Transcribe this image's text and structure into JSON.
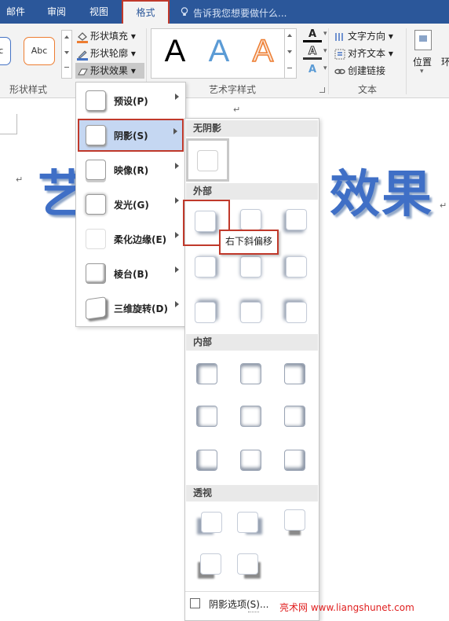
{
  "tabs": [
    "邮件",
    "审阅",
    "视图",
    "格式"
  ],
  "tell_me": "告诉我您想要做什么...",
  "ribbon": {
    "shape_style_thumb": "Abc",
    "shape_fill": "形状填充",
    "shape_outline": "形状轮廓",
    "shape_effects": "形状效果",
    "group_shape_styles": "形状样式",
    "wordart_letter": "A",
    "group_wordart": "艺术字样式",
    "text_direction": "文字方向",
    "align_text": "对齐文本",
    "create_link": "创建链接",
    "group_text": "文本",
    "position": "位置",
    "wrap_partial": "环"
  },
  "doc": {
    "art_left": "艺",
    "art_right": "效果",
    "para_mark": "↵"
  },
  "effects_menu": [
    {
      "label": "预设(P)"
    },
    {
      "label": "阴影(S)"
    },
    {
      "label": "映像(R)"
    },
    {
      "label": "发光(G)"
    },
    {
      "label": "柔化边缘(E)"
    },
    {
      "label": "棱台(B)"
    },
    {
      "label": "三维旋转(D)"
    }
  ],
  "shadow_menu": {
    "no_shadow": "无阴影",
    "outer": "外部",
    "inner": "内部",
    "perspective": "透视",
    "tooltip": "右下斜偏移",
    "options": "阴影选项(S)..."
  },
  "watermark": "亮术网 www.liangshunet.com",
  "colors": {
    "tab_bar": "#2b579a",
    "highlight_red": "#c0392b",
    "menu_selected": "#c5d7f2",
    "wordart_blue": "#3f6fc6"
  }
}
